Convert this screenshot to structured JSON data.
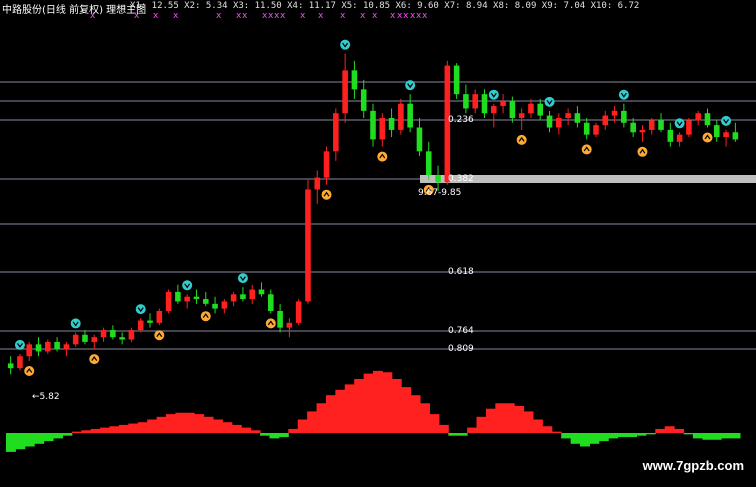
{
  "header": {
    "title": "中路股份(日线 前复权) 理想主图",
    "x_values": "X1: 12.55 X2: 5.34 X3: 11.50 X4: 11.17 X5: 10.85 X6: 9.60 X7: 8.94 X8: 8.09 X9: 7.04 X10: 6.72"
  },
  "markers": {
    "symbol": "x",
    "color": "#ff44ff"
  },
  "fib_levels": [
    {
      "label": "0.236"
    },
    {
      "label": "0.382"
    },
    {
      "label": "0.618"
    },
    {
      "label": "0.764"
    },
    {
      "label": "0.809"
    }
  ],
  "annotations": {
    "low_label": "←5.82",
    "range_label": "9.67-9.85"
  },
  "watermark": "www.7gpzb.com",
  "colors": {
    "background": "#000000",
    "up": "#ff2020",
    "down": "#20dd20",
    "level_line": "#b8b8d8",
    "highlight_band": "#bfbfbf",
    "signal_up": "#ffaa33",
    "signal_down": "#33cccc"
  },
  "chart_data": {
    "type": "candlestick",
    "title": "中路股份(日线 前复权) 理想主图",
    "candles": [
      {
        "o": 6.05,
        "h": 6.2,
        "l": 5.82,
        "c": 5.95
      },
      {
        "o": 5.95,
        "h": 6.25,
        "l": 5.9,
        "c": 6.2
      },
      {
        "o": 6.2,
        "h": 6.5,
        "l": 6.1,
        "c": 6.45
      },
      {
        "o": 6.45,
        "h": 6.6,
        "l": 6.2,
        "c": 6.3
      },
      {
        "o": 6.3,
        "h": 6.55,
        "l": 6.25,
        "c": 6.5
      },
      {
        "o": 6.5,
        "h": 6.6,
        "l": 6.3,
        "c": 6.35
      },
      {
        "o": 6.35,
        "h": 6.5,
        "l": 6.2,
        "c": 6.45
      },
      {
        "o": 6.45,
        "h": 6.7,
        "l": 6.4,
        "c": 6.65
      },
      {
        "o": 6.65,
        "h": 6.75,
        "l": 6.45,
        "c": 6.5
      },
      {
        "o": 6.5,
        "h": 6.65,
        "l": 6.35,
        "c": 6.6
      },
      {
        "o": 6.6,
        "h": 6.8,
        "l": 6.5,
        "c": 6.75
      },
      {
        "o": 6.75,
        "h": 6.85,
        "l": 6.55,
        "c": 6.6
      },
      {
        "o": 6.6,
        "h": 6.7,
        "l": 6.45,
        "c": 6.55
      },
      {
        "o": 6.55,
        "h": 6.8,
        "l": 6.5,
        "c": 6.75
      },
      {
        "o": 6.75,
        "h": 7.0,
        "l": 6.7,
        "c": 6.95
      },
      {
        "o": 6.95,
        "h": 7.1,
        "l": 6.8,
        "c": 6.9
      },
      {
        "o": 6.9,
        "h": 7.2,
        "l": 6.85,
        "c": 7.15
      },
      {
        "o": 7.15,
        "h": 7.6,
        "l": 7.1,
        "c": 7.55
      },
      {
        "o": 7.55,
        "h": 7.7,
        "l": 7.3,
        "c": 7.35
      },
      {
        "o": 7.35,
        "h": 7.5,
        "l": 7.2,
        "c": 7.45
      },
      {
        "o": 7.45,
        "h": 7.6,
        "l": 7.3,
        "c": 7.4
      },
      {
        "o": 7.4,
        "h": 7.55,
        "l": 7.25,
        "c": 7.3
      },
      {
        "o": 7.3,
        "h": 7.45,
        "l": 7.1,
        "c": 7.2
      },
      {
        "o": 7.2,
        "h": 7.4,
        "l": 7.1,
        "c": 7.35
      },
      {
        "o": 7.35,
        "h": 7.55,
        "l": 7.25,
        "c": 7.5
      },
      {
        "o": 7.5,
        "h": 7.65,
        "l": 7.35,
        "c": 7.4
      },
      {
        "o": 7.4,
        "h": 7.7,
        "l": 7.3,
        "c": 7.6
      },
      {
        "o": 7.6,
        "h": 7.75,
        "l": 7.45,
        "c": 7.5
      },
      {
        "o": 7.5,
        "h": 7.6,
        "l": 7.1,
        "c": 7.15
      },
      {
        "o": 7.15,
        "h": 7.3,
        "l": 6.7,
        "c": 6.8
      },
      {
        "o": 6.8,
        "h": 7.0,
        "l": 6.6,
        "c": 6.9
      },
      {
        "o": 6.9,
        "h": 7.4,
        "l": 6.85,
        "c": 7.35
      },
      {
        "o": 7.35,
        "h": 9.9,
        "l": 7.3,
        "c": 9.7
      },
      {
        "o": 9.7,
        "h": 10.1,
        "l": 9.4,
        "c": 9.95
      },
      {
        "o": 9.95,
        "h": 10.6,
        "l": 9.8,
        "c": 10.5
      },
      {
        "o": 10.5,
        "h": 11.4,
        "l": 10.3,
        "c": 11.3
      },
      {
        "o": 11.3,
        "h": 12.55,
        "l": 11.1,
        "c": 12.2
      },
      {
        "o": 12.2,
        "h": 12.4,
        "l": 11.6,
        "c": 11.8
      },
      {
        "o": 11.8,
        "h": 12.0,
        "l": 11.2,
        "c": 11.35
      },
      {
        "o": 11.35,
        "h": 11.5,
        "l": 10.6,
        "c": 10.75
      },
      {
        "o": 10.75,
        "h": 11.3,
        "l": 10.6,
        "c": 11.2
      },
      {
        "o": 11.2,
        "h": 11.4,
        "l": 10.8,
        "c": 10.95
      },
      {
        "o": 10.95,
        "h": 11.6,
        "l": 10.85,
        "c": 11.5
      },
      {
        "o": 11.5,
        "h": 11.7,
        "l": 10.9,
        "c": 11.0
      },
      {
        "o": 11.0,
        "h": 11.2,
        "l": 10.4,
        "c": 10.5
      },
      {
        "o": 10.5,
        "h": 10.7,
        "l": 9.9,
        "c": 10.0
      },
      {
        "o": 10.0,
        "h": 10.2,
        "l": 9.67,
        "c": 9.85
      },
      {
        "o": 9.85,
        "h": 12.4,
        "l": 9.8,
        "c": 12.3
      },
      {
        "o": 12.3,
        "h": 12.35,
        "l": 11.6,
        "c": 11.7
      },
      {
        "o": 11.7,
        "h": 11.9,
        "l": 11.3,
        "c": 11.4
      },
      {
        "o": 11.4,
        "h": 11.8,
        "l": 11.3,
        "c": 11.7
      },
      {
        "o": 11.7,
        "h": 11.8,
        "l": 11.2,
        "c": 11.3
      },
      {
        "o": 11.3,
        "h": 11.5,
        "l": 11.0,
        "c": 11.45
      },
      {
        "o": 11.45,
        "h": 11.7,
        "l": 11.3,
        "c": 11.55
      },
      {
        "o": 11.55,
        "h": 11.65,
        "l": 11.1,
        "c": 11.2
      },
      {
        "o": 11.2,
        "h": 11.4,
        "l": 10.95,
        "c": 11.3
      },
      {
        "o": 11.3,
        "h": 11.6,
        "l": 11.2,
        "c": 11.5
      },
      {
        "o": 11.5,
        "h": 11.6,
        "l": 11.15,
        "c": 11.25
      },
      {
        "o": 11.25,
        "h": 11.35,
        "l": 10.9,
        "c": 11.0
      },
      {
        "o": 11.0,
        "h": 11.3,
        "l": 10.85,
        "c": 11.2
      },
      {
        "o": 11.2,
        "h": 11.4,
        "l": 11.05,
        "c": 11.3
      },
      {
        "o": 11.3,
        "h": 11.45,
        "l": 11.0,
        "c": 11.1
      },
      {
        "o": 11.1,
        "h": 11.2,
        "l": 10.75,
        "c": 10.85
      },
      {
        "o": 10.85,
        "h": 11.1,
        "l": 10.8,
        "c": 11.05
      },
      {
        "o": 11.05,
        "h": 11.35,
        "l": 10.95,
        "c": 11.25
      },
      {
        "o": 11.25,
        "h": 11.45,
        "l": 11.1,
        "c": 11.35
      },
      {
        "o": 11.35,
        "h": 11.5,
        "l": 11.0,
        "c": 11.1
      },
      {
        "o": 11.1,
        "h": 11.2,
        "l": 10.8,
        "c": 10.9
      },
      {
        "o": 10.9,
        "h": 11.05,
        "l": 10.7,
        "c": 10.95
      },
      {
        "o": 10.95,
        "h": 11.2,
        "l": 10.85,
        "c": 11.15
      },
      {
        "o": 11.15,
        "h": 11.3,
        "l": 10.9,
        "c": 10.95
      },
      {
        "o": 10.95,
        "h": 11.1,
        "l": 10.6,
        "c": 10.7
      },
      {
        "o": 10.7,
        "h": 10.9,
        "l": 10.6,
        "c": 10.85
      },
      {
        "o": 10.85,
        "h": 11.2,
        "l": 10.8,
        "c": 11.15
      },
      {
        "o": 11.15,
        "h": 11.35,
        "l": 11.05,
        "c": 11.3
      },
      {
        "o": 11.3,
        "h": 11.4,
        "l": 11.0,
        "c": 11.05
      },
      {
        "o": 11.05,
        "h": 11.15,
        "l": 10.7,
        "c": 10.8
      },
      {
        "o": 10.8,
        "h": 10.95,
        "l": 10.6,
        "c": 10.9
      },
      {
        "o": 10.9,
        "h": 11.1,
        "l": 10.7,
        "c": 10.75
      }
    ],
    "signals_up_at": [
      2,
      9,
      16,
      21,
      28,
      34,
      40,
      45,
      55,
      62,
      68,
      75
    ],
    "signals_down_at": [
      1,
      7,
      14,
      19,
      25,
      36,
      43,
      52,
      58,
      66,
      72,
      77
    ],
    "oscillator": [
      -14,
      -12,
      -10,
      -8,
      -6,
      -4,
      -2,
      1,
      2,
      3,
      4,
      5,
      6,
      7,
      8,
      10,
      12,
      14,
      15,
      15,
      14,
      12,
      10,
      8,
      6,
      4,
      2,
      -2,
      -4,
      -3,
      3,
      10,
      16,
      22,
      28,
      32,
      36,
      40,
      44,
      46,
      45,
      40,
      34,
      28,
      22,
      14,
      6,
      -2,
      -2,
      4,
      12,
      18,
      22,
      22,
      20,
      16,
      10,
      5,
      1,
      -4,
      -8,
      -10,
      -8,
      -6,
      -4,
      -3,
      -3,
      -2,
      -1,
      3,
      5,
      3,
      -1,
      -4,
      -5,
      -5,
      -4,
      -4
    ],
    "oscillator_zero": 0
  }
}
